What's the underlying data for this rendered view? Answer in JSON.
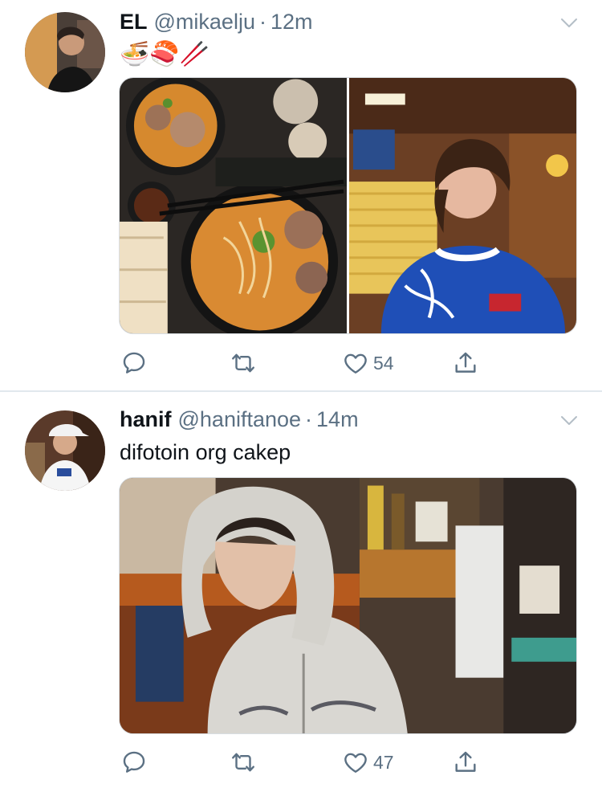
{
  "tweets": [
    {
      "display_name": "EL",
      "handle": "@mikaelju",
      "separator": "·",
      "time": "12m",
      "text": "🍜🍣🥢",
      "avatar_icon": "profile-photo",
      "media_count": 2,
      "likes": "54",
      "actions": [
        "reply-icon",
        "retweet-icon",
        "like-icon",
        "share-icon"
      ]
    },
    {
      "display_name": "hanif",
      "handle": "@haniftanoe",
      "separator": "·",
      "time": "14m",
      "text": "difotoin org cakep",
      "avatar_icon": "profile-photo",
      "media_count": 1,
      "likes": "47",
      "actions": [
        "reply-icon",
        "retweet-icon",
        "like-icon",
        "share-icon"
      ]
    }
  ],
  "colors": {
    "primary_text": "#0f1419",
    "secondary_text": "#5b7083",
    "divider": "#e1e8ed"
  }
}
